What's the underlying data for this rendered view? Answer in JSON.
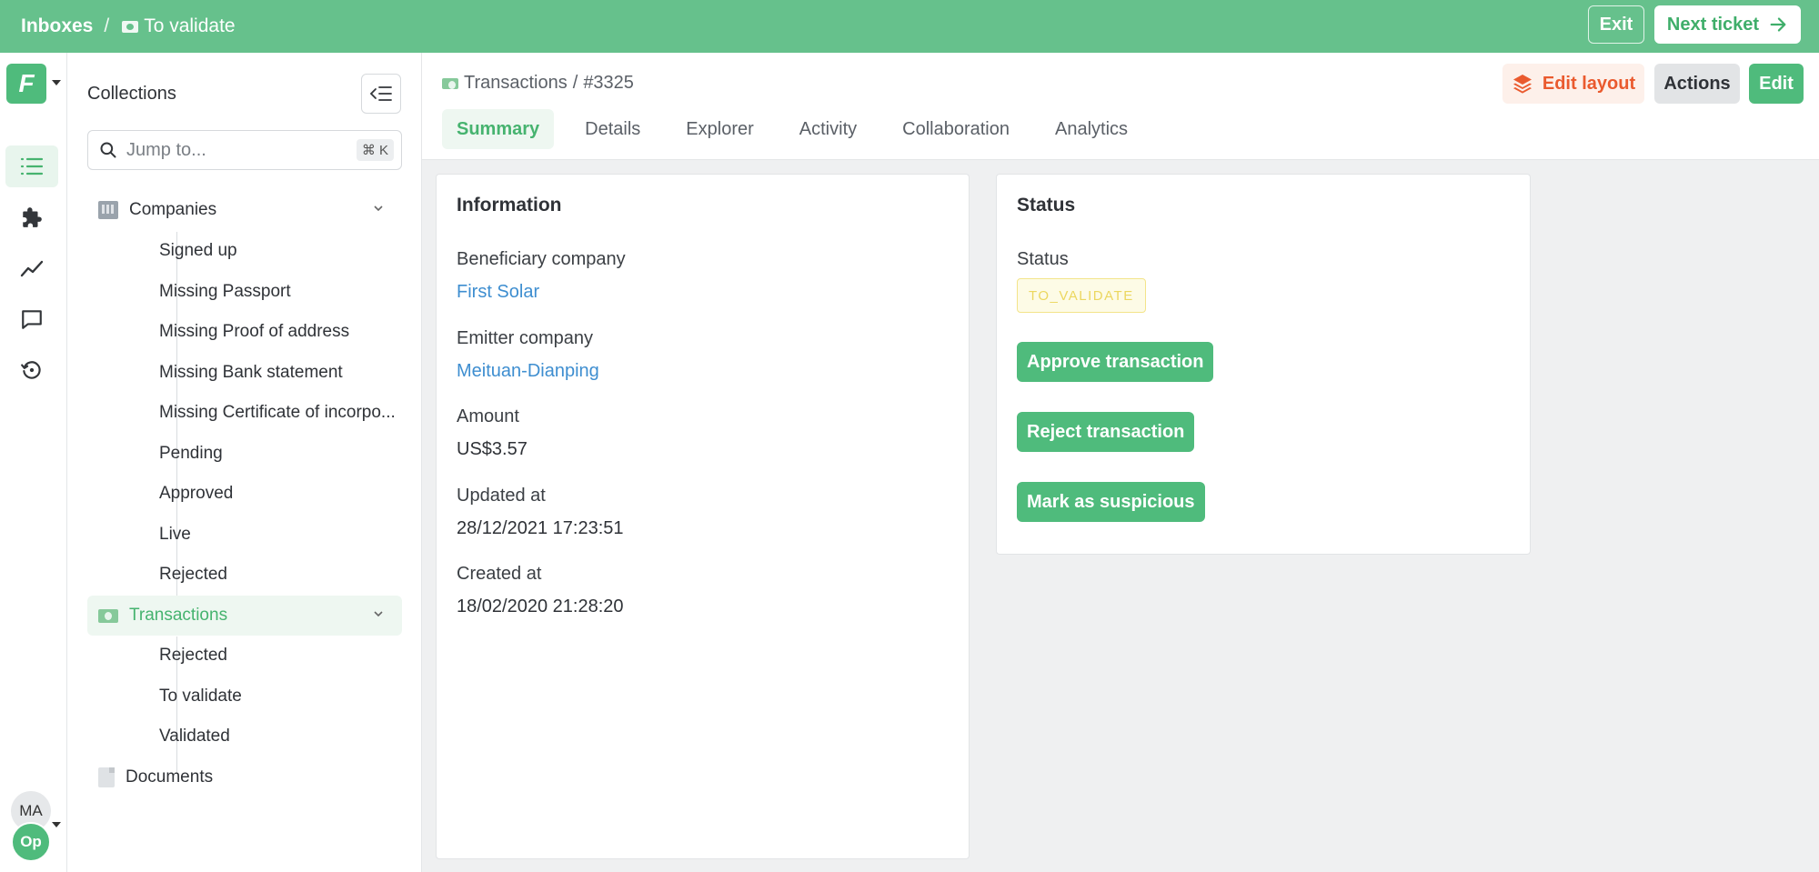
{
  "topbar": {
    "root": "Inboxes",
    "separator": "/",
    "current": "To validate",
    "exit_label": "Exit",
    "next_label": "Next ticket"
  },
  "rail": {
    "logo_letter": "F",
    "items": [
      "list-icon",
      "puzzle-icon",
      "chart-line-icon",
      "chat-icon",
      "history-icon"
    ],
    "avatar_user": "MA",
    "avatar_org": "Op"
  },
  "sidebar": {
    "title": "Collections",
    "jump_placeholder": "Jump to...",
    "shortcut": "⌘ K",
    "companies": {
      "label": "Companies",
      "children": [
        "Signed up",
        "Missing Passport",
        "Missing Proof of address",
        "Missing Bank statement",
        "Missing Certificate of incorpo...",
        "Pending",
        "Approved",
        "Live",
        "Rejected"
      ]
    },
    "transactions": {
      "label": "Transactions",
      "children": [
        "Rejected",
        "To validate",
        "Validated"
      ]
    },
    "documents": {
      "label": "Documents"
    }
  },
  "record": {
    "collection": "Transactions",
    "separator": "/",
    "id": "#3325",
    "edit_layout_label": "Edit layout",
    "actions_label": "Actions",
    "edit_label": "Edit",
    "tabs": [
      "Summary",
      "Details",
      "Explorer",
      "Activity",
      "Collaboration",
      "Analytics"
    ]
  },
  "information": {
    "title": "Information",
    "fields": [
      {
        "label": "Beneficiary company",
        "value": "First Solar"
      },
      {
        "label": "Emitter company",
        "value": "Meituan-Dianping"
      },
      {
        "label": "Amount",
        "value": "US$3.57"
      },
      {
        "label": "Updated at",
        "value": "28/12/2021 17:23:51"
      },
      {
        "label": "Created at",
        "value": "18/02/2020 21:28:20"
      }
    ]
  },
  "status": {
    "title": "Status",
    "field_label": "Status",
    "value": "TO_VALIDATE",
    "buttons": [
      "Approve transaction",
      "Reject transaction",
      "Mark as suspicious"
    ]
  },
  "colors": {
    "brand_green": "#66c18c",
    "button_green": "#4fbb7c",
    "link_blue": "#3e8ed0",
    "edit_layout_orange": "#ea5a2e",
    "badge_yellow": "#ecd75f"
  }
}
